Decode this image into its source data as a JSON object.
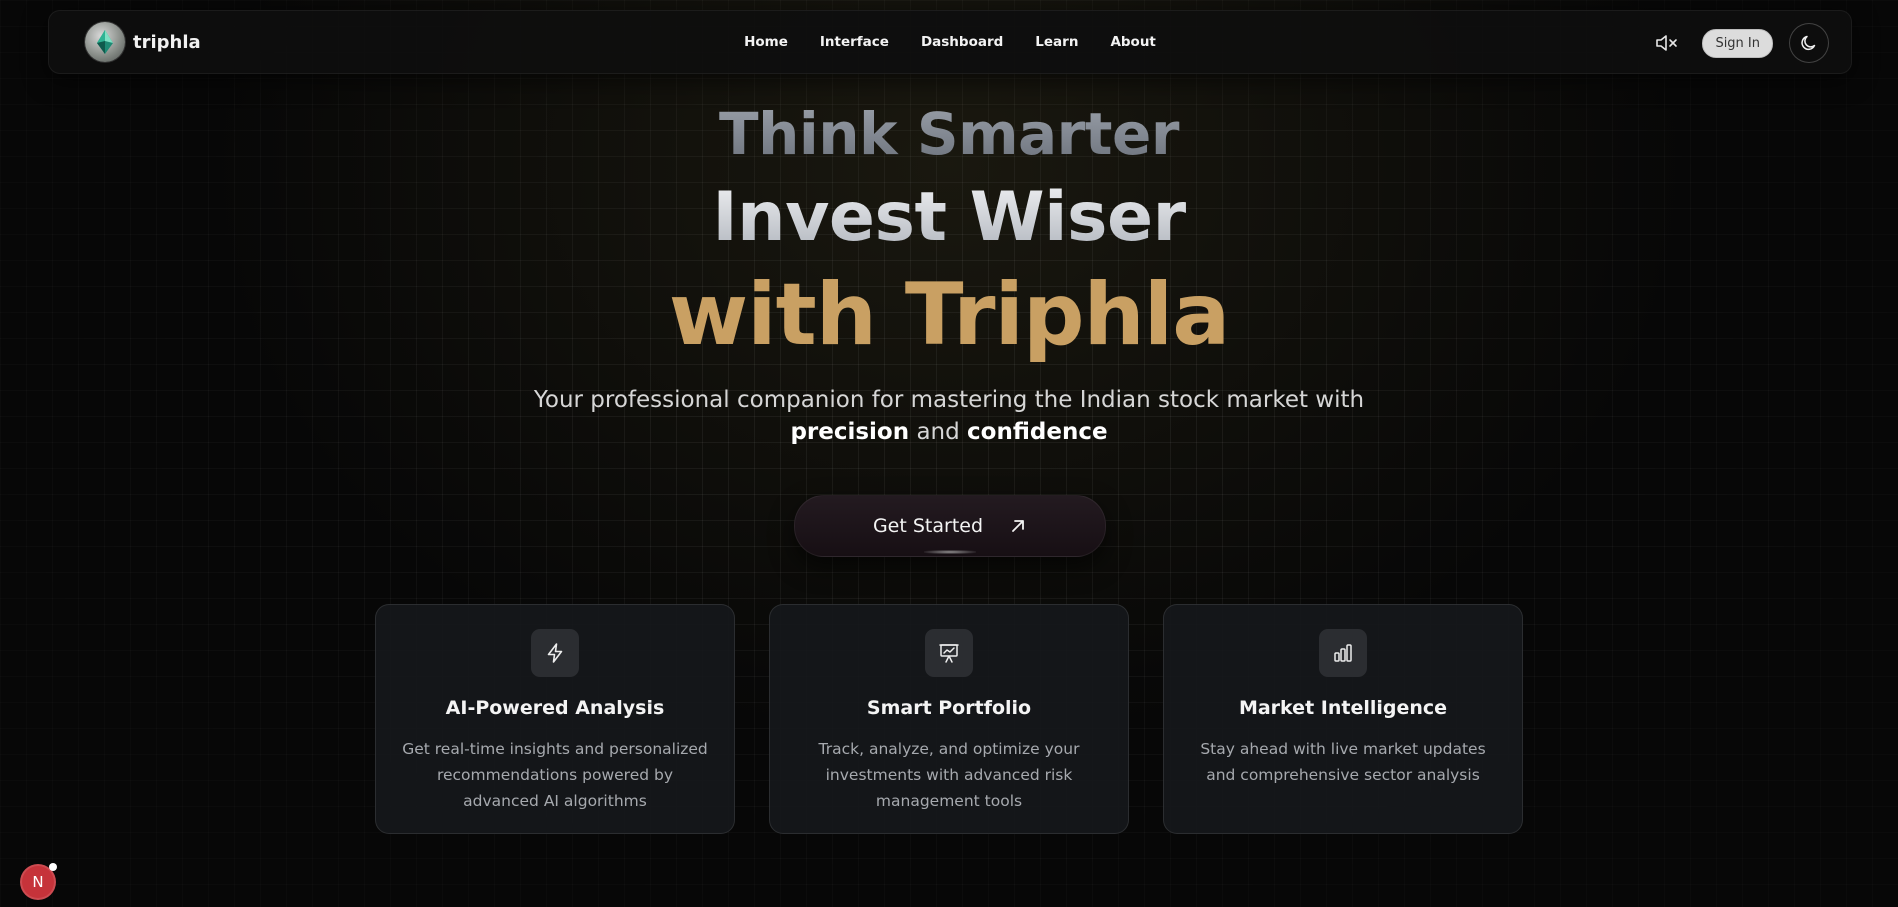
{
  "brand": {
    "name": "triphla"
  },
  "nav": {
    "links": [
      "Home",
      "Interface",
      "Dashboard",
      "Learn",
      "About"
    ]
  },
  "header_actions": {
    "mute_icon": "speaker-muted-icon",
    "signin_label": "Sign In",
    "theme_icon": "moon-icon"
  },
  "hero": {
    "line1": "Think Smarter",
    "line2": "Invest Wiser",
    "line3": "with Triphla",
    "subtitle_prefix": "Your professional companion for mastering the Indian stock market with",
    "subtitle_bold1": "precision",
    "subtitle_and": "and",
    "subtitle_bold2": "confidence",
    "cta_label": "Get Started",
    "cta_icon": "arrow-up-right-icon"
  },
  "features": [
    {
      "icon": "lightning-icon",
      "title": "AI-Powered Analysis",
      "description": "Get real-time insights and personalized recommendations powered by advanced AI algorithms"
    },
    {
      "icon": "presentation-chart-icon",
      "title": "Smart Portfolio",
      "description": "Track, analyze, and optimize your investments with advanced risk management tools"
    },
    {
      "icon": "bar-chart-icon",
      "title": "Market Intelligence",
      "description": "Stay ahead with live market updates and comprehensive sector analysis"
    }
  ],
  "floating_badge": {
    "label": "N"
  },
  "colors": {
    "background": "#070707",
    "accent_gold": "#c9a063",
    "cta_bg": "#1d1419",
    "badge_red": "#c6333a"
  }
}
